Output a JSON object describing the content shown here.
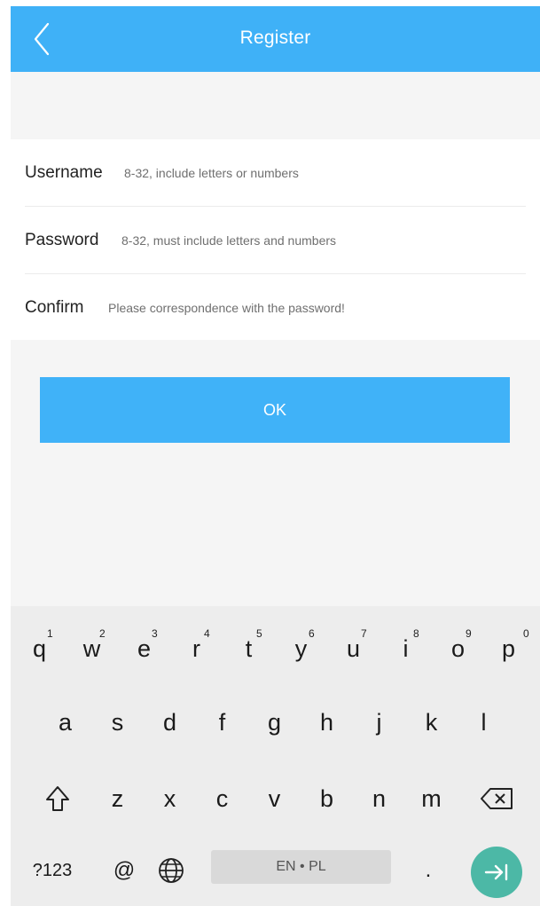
{
  "header": {
    "title": "Register",
    "back_icon": "chevron-left-icon"
  },
  "form": {
    "username": {
      "label": "Username",
      "placeholder": "8-32, include letters or numbers"
    },
    "password": {
      "label": "Password",
      "placeholder": "8-32, must include letters and numbers"
    },
    "confirm": {
      "label": "Confirm",
      "placeholder": "Please correspondence with the password!"
    }
  },
  "ok_button": {
    "label": "OK"
  },
  "keyboard": {
    "row1": [
      {
        "key": "q",
        "hint": "1"
      },
      {
        "key": "w",
        "hint": "2"
      },
      {
        "key": "e",
        "hint": "3"
      },
      {
        "key": "r",
        "hint": "4"
      },
      {
        "key": "t",
        "hint": "5"
      },
      {
        "key": "y",
        "hint": "6"
      },
      {
        "key": "u",
        "hint": "7"
      },
      {
        "key": "i",
        "hint": "8"
      },
      {
        "key": "o",
        "hint": "9"
      },
      {
        "key": "p",
        "hint": "0"
      }
    ],
    "row2": [
      "a",
      "s",
      "d",
      "f",
      "g",
      "h",
      "j",
      "k",
      "l"
    ],
    "row3": [
      "z",
      "x",
      "c",
      "v",
      "b",
      "n",
      "m"
    ],
    "symbols_label": "?123",
    "at_label": "@",
    "space_label": "EN • PL",
    "period_label": "."
  },
  "colors": {
    "accent": "#3fb1f7",
    "enter_key": "#4cb8a6",
    "keyboard_bg": "#ededed",
    "space_bar": "#d9d9d9"
  }
}
